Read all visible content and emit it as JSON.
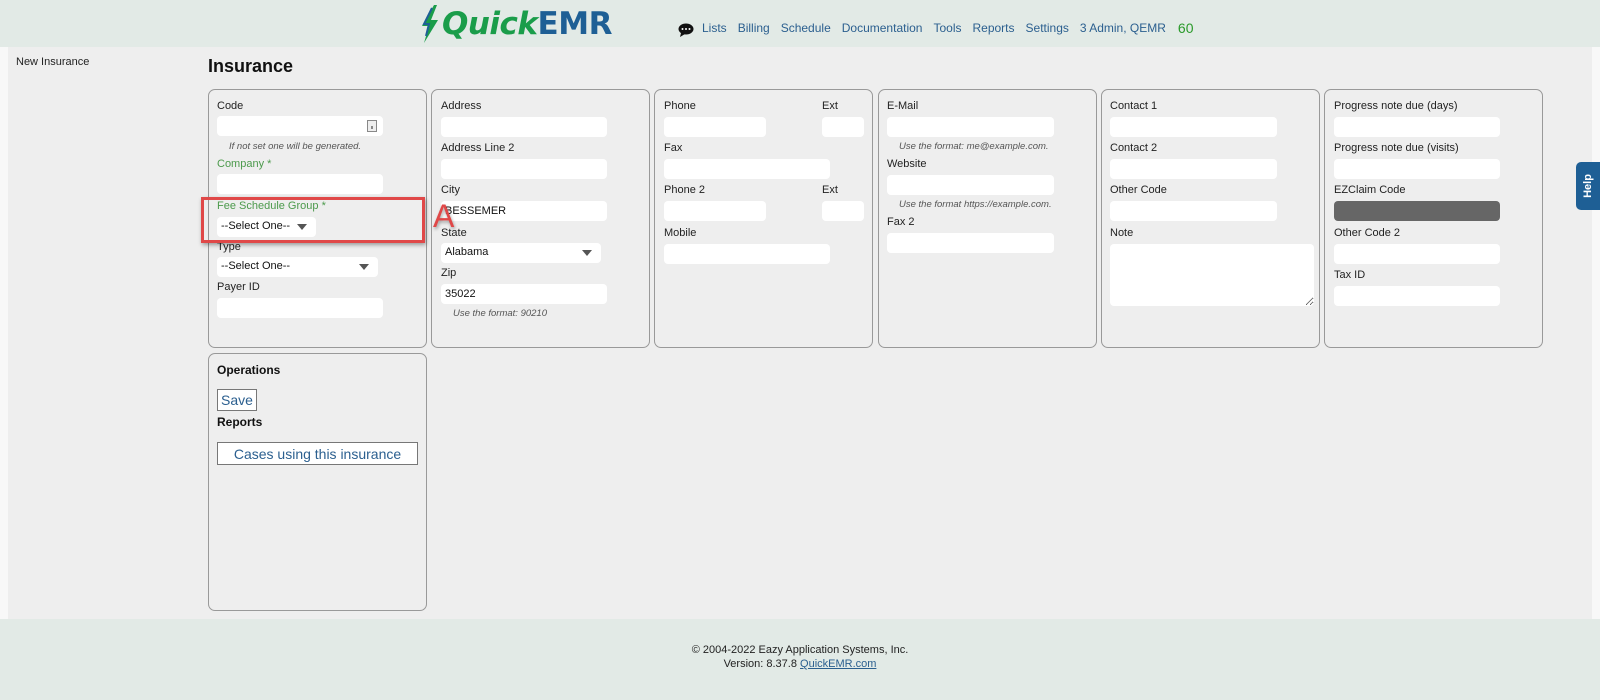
{
  "header": {
    "logo_quick": "Quick",
    "logo_emr": "EMR",
    "nav": [
      "Lists",
      "Billing",
      "Schedule",
      "Documentation",
      "Tools",
      "Reports",
      "Settings",
      "3 Admin, QEMR"
    ],
    "count": "60",
    "chat_icon": "chat-bubble-icon"
  },
  "sidebar": {
    "new_insurance": "New Insurance"
  },
  "page": {
    "title": "Insurance"
  },
  "panel1": {
    "code_label": "Code",
    "code_value": "",
    "code_hint": "If not set one will be generated.",
    "company_label": "Company *",
    "company_value": "",
    "fee_schedule_label": "Fee Schedule Group *",
    "fee_schedule_value": "--Select One--",
    "type_label": "Type",
    "type_value": "--Select One--",
    "payer_id_label": "Payer ID",
    "payer_id_value": ""
  },
  "panel2": {
    "address_label": "Address",
    "address_value": "",
    "address2_label": "Address Line 2",
    "address2_value": "",
    "city_label": "City",
    "city_value": "BESSEMER",
    "state_label": "State",
    "state_value": "Alabama",
    "zip_label": "Zip",
    "zip_value": "35022",
    "zip_hint": "Use the format: 90210"
  },
  "panel3": {
    "phone_label": "Phone",
    "ext_label": "Ext",
    "fax_label": "Fax",
    "phone2_label": "Phone 2",
    "ext2_label": "Ext",
    "mobile_label": "Mobile"
  },
  "panel4": {
    "email_label": "E-Mail",
    "email_hint": "Use the format: me@example.com.",
    "website_label": "Website",
    "website_hint": "Use the format https://example.com.",
    "fax2_label": "Fax 2"
  },
  "panel5": {
    "contact1_label": "Contact 1",
    "contact2_label": "Contact 2",
    "other_code_label": "Other Code",
    "note_label": "Note"
  },
  "panel6": {
    "progress_days_label": "Progress note due (days)",
    "progress_visits_label": "Progress note due (visits)",
    "ezclaim_label": "EZClaim Code",
    "other_code2_label": "Other Code 2",
    "tax_id_label": "Tax ID"
  },
  "operations": {
    "title": "Operations",
    "save_label": "Save",
    "reports_title": "Reports",
    "cases_label": "Cases using this insurance"
  },
  "annotation": {
    "letter": "A"
  },
  "help": {
    "label": "Help"
  },
  "footer": {
    "copyright": "© 2004-2022 Eazy Application Systems, Inc.",
    "version": "Version: 8.37.8",
    "link": "QuickEMR.com"
  }
}
